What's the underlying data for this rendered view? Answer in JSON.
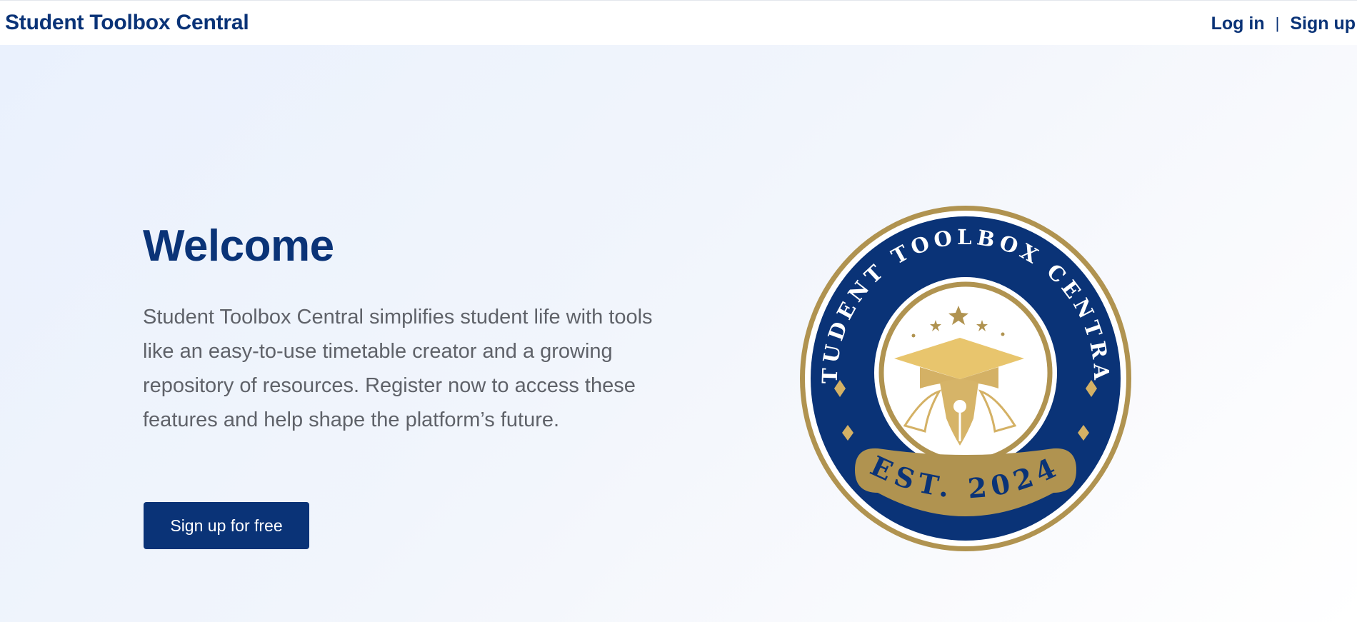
{
  "nav": {
    "brand": "Student Toolbox Central",
    "login_label": "Log in",
    "separator": "|",
    "signup_label": "Sign up"
  },
  "hero": {
    "title": "Welcome",
    "intro": "Student Toolbox Central simplifies student life with tools like an easy-to-use timetable creator and a growing repository of resources. Register now to access these features and help shape the platform’s future.",
    "cta_label": "Sign up for free"
  },
  "emblem": {
    "arc_text": "STUDENT TOOLBOX CENTRAL",
    "banner_text": "EST. 2024"
  },
  "colors": {
    "brand_navy": "#0a3377",
    "gold": "#b09350",
    "light_gold": "#e8c56d",
    "body_text": "#5f6269"
  }
}
